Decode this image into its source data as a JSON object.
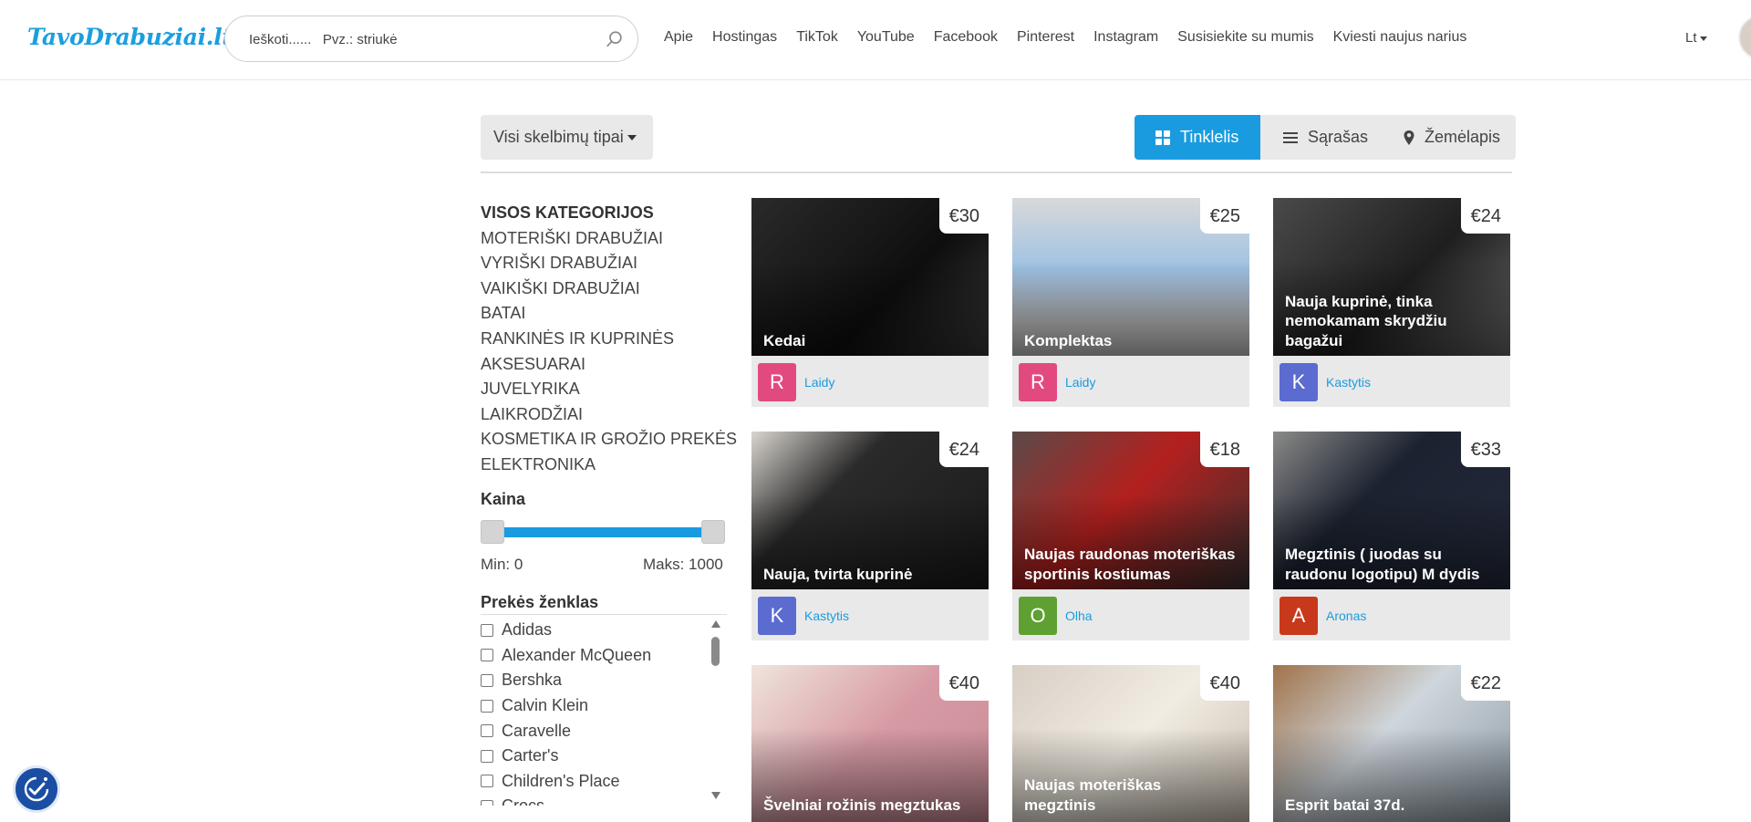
{
  "header": {
    "logo": "TavoDrabuziai.lt",
    "search_placeholder": "Ieškoti......   Pvz.: striukė",
    "nav": [
      "Apie",
      "Hostingas",
      "TikTok",
      "YouTube",
      "Facebook",
      "Pinterest",
      "Instagram",
      "Susisiekite su mumis",
      "Kviesti naujus narius"
    ],
    "lang": "Lt"
  },
  "toolbar": {
    "type_filter": "Visi skelbimų tipai",
    "views": {
      "grid": "Tinklelis",
      "list": "Sąrašas",
      "map": "Žemėlapis"
    },
    "active_view": "grid"
  },
  "sidebar": {
    "categories_title": "VISOS KATEGORIJOS",
    "categories": [
      "MOTERIŠKI DRABUŽIAI",
      "VYRIŠKI DRABUŽIAI",
      "VAIKIŠKI DRABUŽIAI",
      "BATAI",
      "RANKINĖS IR KUPRINĖS",
      "AKSESUARAI",
      "JUVELYRIKA",
      "LAIKRODŽIAI",
      "KOSMETIKA IR GROŽIO PREKĖS",
      "ELEKTRONIKA"
    ],
    "price_title": "Kaina",
    "price_min_label": "Min: 0",
    "price_max_label": "Maks: 1000",
    "brand_title": "Prekės ženklas",
    "brands": [
      "Adidas",
      "Alexander McQueen",
      "Bershka",
      "Calvin Klein",
      "Caravelle",
      "Carter's",
      "Children's Place",
      "Crocs"
    ]
  },
  "listings": [
    {
      "price": "€30",
      "title": "Kedai",
      "initial": "R",
      "seller": "Laidy",
      "color": "#e24a7f",
      "bg": "linear-gradient(135deg,#2a2a2a,#0e0e0e 60%,#3a3a3a)"
    },
    {
      "price": "€25",
      "title": "Komplektas",
      "initial": "R",
      "seller": "Laidy",
      "color": "#e24a7f",
      "bg": "linear-gradient(180deg,#d9d9d9,#9fc2e4 45%,#c8c8c8 80%)"
    },
    {
      "price": "€24",
      "title": "Nauja kuprinė, tinka nemokamam skrydžiu bagažui",
      "initial": "K",
      "seller": "Kastytis",
      "color": "#5b6bd0",
      "bg": "linear-gradient(135deg,#4a4a4a,#1e1e1e 55%,#6a6a6a)"
    },
    {
      "price": "€24",
      "title": "Nauja, tvirta kuprinė",
      "initial": "K",
      "seller": "Kastytis",
      "color": "#5b6bd0",
      "bg": "linear-gradient(135deg,#d9d5cf,#2a2a2a 35%,#1a1a1a)"
    },
    {
      "price": "€18",
      "title": "Naujas raudonas moteriškas sportinis kostiumas",
      "initial": "O",
      "seller": "Olha",
      "color": "#5fa032",
      "bg": "linear-gradient(135deg,#5a4a48,#b3201e 45%,#3a3030)"
    },
    {
      "price": "€33",
      "title": "Megztinis ( juodas su raudonu logotipu) M dydis",
      "initial": "A",
      "seller": "Aronas",
      "color": "#c8391c",
      "bg": "linear-gradient(135deg,#8a8a88,#1c2230 40%,#23293a)"
    },
    {
      "price": "€40",
      "title": "Švelniai rožinis megztukas",
      "initial": "",
      "seller": "",
      "color": "#999",
      "bg": "linear-gradient(135deg,#efe4dc,#d79aa4 50%,#c98d98)"
    },
    {
      "price": "€40",
      "title": "Naujas moteriškas megztinis",
      "initial": "",
      "seller": "",
      "color": "#999",
      "bg": "linear-gradient(135deg,#d8cfc5,#f1ece2 50%,#c7bdb0)"
    },
    {
      "price": "€22",
      "title": "Esprit batai 37d.",
      "initial": "",
      "seller": "",
      "color": "#999",
      "bg": "linear-gradient(135deg,#a0734a,#cfd6dc 45%,#8c9aa4)"
    }
  ]
}
